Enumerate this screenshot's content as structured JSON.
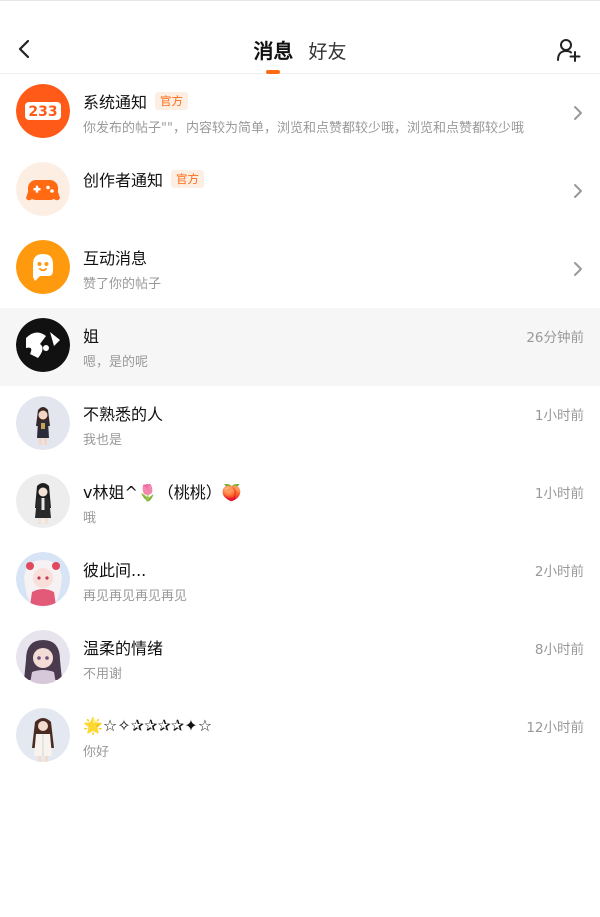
{
  "header": {
    "tabs": [
      {
        "label": "消息",
        "active": true
      },
      {
        "label": "好友",
        "active": false
      }
    ],
    "accent_color": "#ff6a13"
  },
  "system_items": [
    {
      "name": "系统通知",
      "badge": "官方",
      "preview": "你发布的帖子\"\"，内容较为简单，浏览和点赞都较少哦，浏览和点赞都较少哦",
      "icon": "233-logo-icon"
    },
    {
      "name": "创作者通知",
      "badge": "官方",
      "preview": "",
      "icon": "gamepad-icon"
    },
    {
      "name": "互动消息",
      "badge": "",
      "preview": "赞了你的帖子",
      "icon": "ghost-chat-icon"
    }
  ],
  "conversations": [
    {
      "name": "姐",
      "preview": "嗯，是的呢",
      "time": "26分钟前"
    },
    {
      "name": "不熟悉的人",
      "preview": "我也是",
      "time": "1小时前"
    },
    {
      "name": "v林姐^🌷（桃桃）🍑",
      "preview": "哦",
      "time": "1小时前"
    },
    {
      "name": "彼此间...",
      "preview": "再见再见再见再见",
      "time": "2小时前"
    },
    {
      "name": "温柔的情绪",
      "preview": "不用谢",
      "time": "8小时前"
    },
    {
      "name": "🌟☆✧✰✰✰✰✦☆",
      "preview": "你好",
      "time": "12小时前"
    }
  ]
}
